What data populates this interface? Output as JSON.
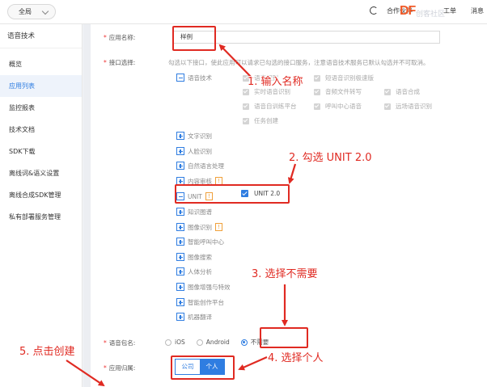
{
  "topbar": {
    "scope": "全局",
    "items": [
      "合作伙伴",
      "工单",
      "消息"
    ],
    "logo": "DF",
    "logo_watermark": "创客社区"
  },
  "sidebar": {
    "title": "语音技术",
    "items": [
      {
        "label": "概览"
      },
      {
        "label": "应用列表",
        "active": true
      },
      {
        "label": "监控报表"
      },
      {
        "label": "技术文档"
      },
      {
        "label": "SDK下载"
      },
      {
        "label": "离线词&语义设置"
      },
      {
        "label": "离线合成SDK管理"
      },
      {
        "label": "私有部署服务管理"
      }
    ]
  },
  "form": {
    "app_name_label": "应用名称:",
    "app_name_value": "样例",
    "api_label": "接口选择:",
    "api_hint": "勾选以下接口，使此应用可以请求已勾选的接口服务，注意语音技术服务已默认勾选并不可取消。",
    "speech_group": "语音技术",
    "speech_subs": [
      "语音识别",
      "短语音识别极速版",
      "实时语音识别",
      "音频文件转写",
      "语音合成",
      "语音自训练平台",
      "呼叫中心语音",
      "远场语音识别",
      "任务创建"
    ],
    "groups": [
      "文字识别",
      "人脸识别",
      "自然语言处理",
      "内容审核",
      "UNIT",
      "知识图谱",
      "图像识别",
      "智能呼叫中心",
      "图像搜索",
      "人体分析",
      "图像增强与特效",
      "智能创作平台",
      "机器翻译"
    ],
    "warn_glyph": "!",
    "unit_option": "UNIT 2.0",
    "package_label": "语音包名:",
    "package_options": [
      "iOS",
      "Android",
      "不需要"
    ],
    "package_selected": "不需要",
    "owner_label": "应用归属:",
    "owner_options": [
      "公司",
      "个人"
    ],
    "owner_selected": "个人",
    "required_mark": "*"
  },
  "annotations": {
    "step1": "1. 输入名称",
    "step2": "2. 勾选 UNIT 2.0",
    "step3": "3. 选择不需要",
    "step4": "4. 选择个人",
    "step5": "5. 点击创建",
    "color": "#e02a22"
  },
  "colors": {
    "accent": "#2f7de1",
    "warning": "#f0a03a",
    "annotation": "#e02a22"
  }
}
